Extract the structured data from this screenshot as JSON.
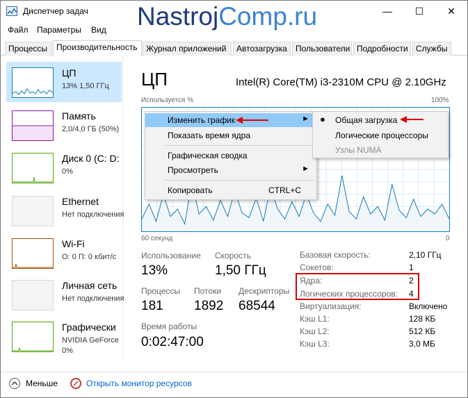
{
  "window": {
    "title": "Диспетчер задач",
    "watermark_a": "Nastroj",
    "watermark_b": "Comp.ru"
  },
  "menubar": [
    "Файл",
    "Параметры",
    "Вид"
  ],
  "tabs": [
    "Процессы",
    "Производительность",
    "Журнал приложений",
    "Автозагрузка",
    "Пользователи",
    "Подробности",
    "Службы"
  ],
  "sidebar": [
    {
      "title": "ЦП",
      "sub": "13% 1,50 ГГц",
      "color": "#117dbb"
    },
    {
      "title": "Память",
      "sub": "2,0/4,0 ГБ (50%)",
      "color": "#8b12ae"
    },
    {
      "title": "Диск 0 (C: D:",
      "sub": "0%",
      "color": "#4da60c"
    },
    {
      "title": "Ethernet",
      "sub": "Нет подключения",
      "color": "#a74f01"
    },
    {
      "title": "Wi-Fi",
      "sub": "О: 0 П: 0 кбит/с",
      "color": "#a74f01"
    },
    {
      "title": "Личная сеть",
      "sub": "Нет подключения",
      "color": "#a74f01"
    },
    {
      "title": "Графически",
      "sub": "NVIDIA GeForce",
      "sub2": "0%",
      "color": "#4da60c"
    }
  ],
  "main": {
    "title": "ЦП",
    "cpu_model": "Intel(R) Core(TM) i3-2310M CPU @ 2.10GHz",
    "usage_label": "Используется %",
    "max_label": "100%",
    "time_label": "60 секунд",
    "zero_label": "0"
  },
  "context_menu": {
    "items": [
      {
        "label": "Изменить график",
        "submenu": true
      },
      {
        "label": "Показать время ядра"
      },
      {
        "label": "Графическая сводка"
      },
      {
        "label": "Просмотреть",
        "submenu": true
      },
      {
        "label": "Копировать",
        "shortcut": "CTRL+C"
      }
    ],
    "submenu_items": [
      {
        "label": "Общая загрузка",
        "checked": true
      },
      {
        "label": "Логические процессоры"
      },
      {
        "label": "Узлы NUMA",
        "disabled": true
      }
    ]
  },
  "stats": {
    "usage_label": "Использование",
    "usage": "13%",
    "speed_label": "Скорость",
    "speed": "1,50 ГГц",
    "processes_label": "Процессы",
    "processes": "181",
    "threads_label": "Потоки",
    "threads": "1892",
    "handles_label": "Дескрипторы",
    "handles": "68544",
    "uptime_label": "Время работы",
    "uptime": "0:02:47:00"
  },
  "details": [
    {
      "label": "Базовая скорость:",
      "value": "2,10 ГГц"
    },
    {
      "label": "Сокетов:",
      "value": "1"
    },
    {
      "label": "Ядра:",
      "value": "2"
    },
    {
      "label": "Логических процессоров:",
      "value": "4"
    },
    {
      "label": "Виртуализация:",
      "value": "Включено"
    },
    {
      "label": "Кэш L1:",
      "value": "128 КБ"
    },
    {
      "label": "Кэш L2:",
      "value": "512 КБ"
    },
    {
      "label": "Кэш L3:",
      "value": "3,0 МБ"
    }
  ],
  "footer": {
    "less": "Меньше",
    "monitor": "Открыть монитор ресурсов"
  },
  "graph_series": [
    10,
    22,
    8,
    30,
    12,
    18,
    6,
    40,
    14,
    20,
    9,
    25,
    12,
    33,
    15,
    11,
    27,
    8,
    36,
    18,
    10,
    24,
    12,
    30,
    15,
    8,
    22,
    13,
    45,
    16,
    10,
    28,
    14,
    20,
    9,
    38,
    17,
    11,
    26,
    12,
    18,
    14,
    22,
    10
  ]
}
